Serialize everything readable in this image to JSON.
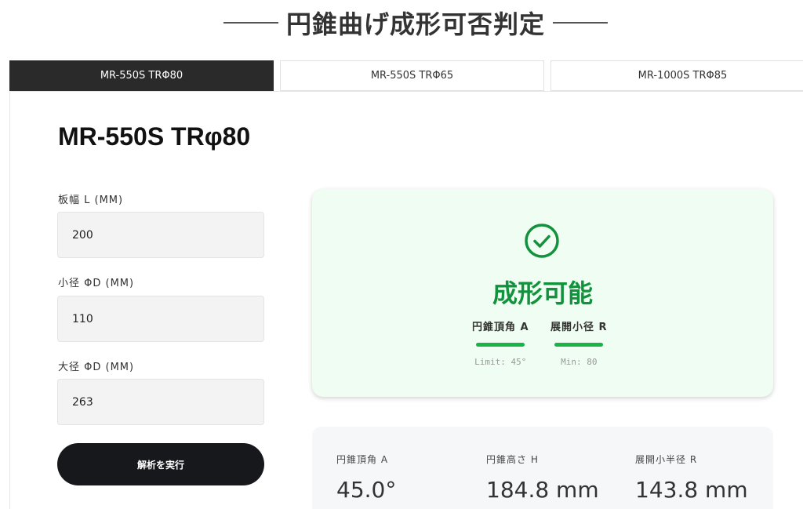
{
  "page_title": "円錐曲げ成形可否判定",
  "tabs": [
    {
      "label": "MR-550S TRΦ80",
      "active": true
    },
    {
      "label": "MR-550S TRΦ65",
      "active": false
    },
    {
      "label": "MR-1000S TRΦ85",
      "active": false
    }
  ],
  "machine_title": "MR-550S TRφ80",
  "form": {
    "plate_width": {
      "label": "板幅 L (MM)",
      "value": "200"
    },
    "small_diameter": {
      "label": "小径 ΦD (MM)",
      "value": "110"
    },
    "large_diameter": {
      "label": "大径 ΦD (MM)",
      "value": "263"
    },
    "run_label": "解析を実行"
  },
  "result": {
    "status": "成形可能",
    "status_color": "#13923d",
    "icon": "check-circle-icon",
    "metrics": [
      {
        "label": "円錐頂角 A",
        "limit": "Limit: 45°"
      },
      {
        "label": "展開小径 R",
        "limit": "Min: 80"
      }
    ]
  },
  "stats": [
    {
      "label": "円錐頂角 A",
      "value": "45.0°"
    },
    {
      "label": "円錐高さ H",
      "value": "184.8 mm"
    },
    {
      "label": "展開小半径 R",
      "value": "143.8 mm"
    }
  ]
}
